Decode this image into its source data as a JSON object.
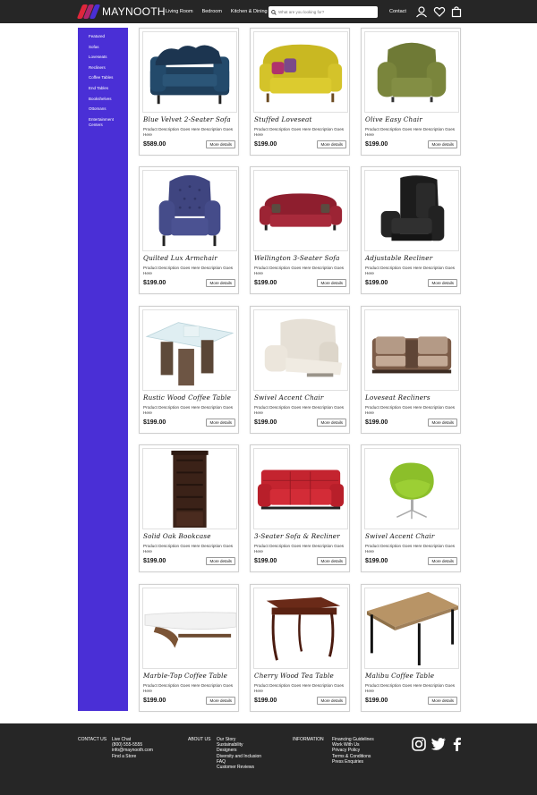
{
  "header": {
    "brand": "MAYNOOTH",
    "nav": [
      "Living Room",
      "Bedroom",
      "Kitchen & Dining"
    ],
    "search_placeholder": "What are you looking for?",
    "contact": "Contact",
    "icons": [
      "account-icon",
      "heart-icon",
      "bag-icon"
    ]
  },
  "sidebar": {
    "items": [
      "Featured",
      "Sofas",
      "Loveseats",
      "Recliners",
      "Coffee Tables",
      "End Tables",
      "Bookshelves",
      "Ottomans",
      "Entertainment Centers"
    ]
  },
  "colors": {
    "accent": "#4a2fd6",
    "header_bg": "#262626"
  },
  "products": [
    {
      "title": "Blue Velvet 2-Seater Sofa",
      "desc": "Product Description Goes Here Description Goes Here",
      "price": "$589.00",
      "button": "More details",
      "image": "blue-velvet-sofa"
    },
    {
      "title": "Stuffed Loveseat",
      "desc": "Product Description Goes Here Description Goes Here",
      "price": "$199.00",
      "button": "More details",
      "image": "yellow-loveseat"
    },
    {
      "title": "Olive Easy Chair",
      "desc": "Product Description Goes Here Description Goes Here",
      "price": "$199.00",
      "button": "More details",
      "image": "olive-easy-chair"
    },
    {
      "title": "Quilted Lux Armchair",
      "desc": "Product Description Goes Here Description Goes Here",
      "price": "$199.00",
      "button": "More details",
      "image": "quilted-armchair"
    },
    {
      "title": "Wellington 3-Seater Sofa",
      "desc": "Product Description Goes Here Description Goes Here",
      "price": "$199.00",
      "button": "More details",
      "image": "red-three-seater"
    },
    {
      "title": "Adjustable Recliner",
      "desc": "Product Description Goes Here Description Goes Here",
      "price": "$199.00",
      "button": "More details",
      "image": "black-recliner"
    },
    {
      "title": "Rustic Wood Coffee Table",
      "desc": "Product Description Goes Here Description Goes Here",
      "price": "$199.00",
      "button": "More details",
      "image": "glass-wood-table"
    },
    {
      "title": "Swivel Accent Chair",
      "desc": "Product Description Goes Here Description Goes Here",
      "price": "$199.00",
      "button": "More details",
      "image": "cream-recliner"
    },
    {
      "title": "Loveseat Recliners",
      "desc": "Product Description Goes Here Description Goes Here",
      "price": "$199.00",
      "button": "More details",
      "image": "brown-loveseat-recliner"
    },
    {
      "title": "Solid Oak Bookcase",
      "desc": "Product Description Goes Here Description Goes Here",
      "price": "$199.00",
      "button": "More details",
      "image": "dark-bookcase"
    },
    {
      "title": "3-Seater Sofa & Recliner",
      "desc": "Product Description Goes Here Description Goes Here",
      "price": "$199.00",
      "button": "More details",
      "image": "red-leather-sofa"
    },
    {
      "title": "Swivel Accent Chair",
      "desc": "Product Description Goes Here Description Goes Here",
      "price": "$199.00",
      "button": "More details",
      "image": "green-swivel-chair"
    },
    {
      "title": "Marble-Top Coffee Table",
      "desc": "Product Description Goes Here Description Goes Here",
      "price": "$199.00",
      "button": "More details",
      "image": "marble-coffee-table"
    },
    {
      "title": "Cherry Wood Tea Table",
      "desc": "Product Description Goes Here Description Goes Here",
      "price": "$199.00",
      "button": "More details",
      "image": "cherry-tea-table"
    },
    {
      "title": "Malibu Coffee Table",
      "desc": "Product Description Goes Here Description Goes Here",
      "price": "$199.00",
      "button": "More details",
      "image": "malibu-table"
    }
  ],
  "footer": {
    "contact_heading": "CONTACT US",
    "contact_lines": [
      "Live Chat",
      "(800) 555-5555",
      "info@maynooth.com",
      "Find a Store"
    ],
    "about_heading": "ABOUT US",
    "about_lines": [
      "Our Story",
      "Sustainability",
      "Designers",
      "Diversity and Inclusion",
      "FAQ",
      "Customer Reviews"
    ],
    "info_heading": "INFORMATION",
    "info_lines": [
      "Financing Guidelines",
      "Work With Us",
      "Privacy Policy",
      "Terms & Conditions",
      "Press Enquiries"
    ],
    "social": [
      "instagram-icon",
      "twitter-icon",
      "facebook-icon"
    ]
  }
}
